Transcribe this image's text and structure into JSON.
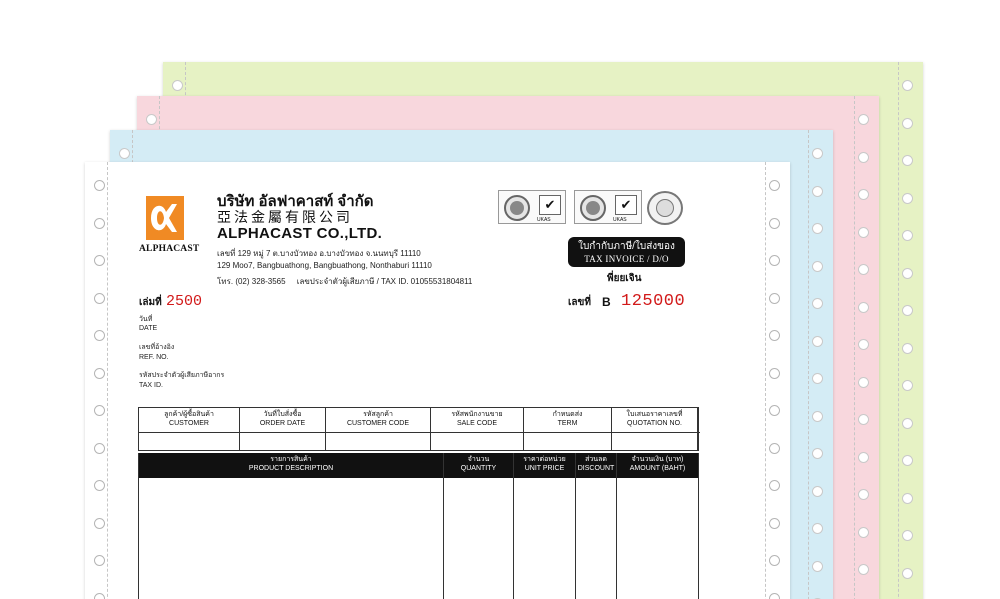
{
  "company": {
    "logo_text": "ALPHACAST",
    "name_thai": "บริษัท อัลฟาคาสท์ จำกัด",
    "name_chinese": "亞法金屬有限公司",
    "name_english": "ALPHACAST CO.,LTD.",
    "address_thai": "เลขที่ 129 หมู่ 7 ต.บางบัวทอง อ.บางบัวทอง จ.นนทบุรี 11110",
    "address_english": "129 Moo7, Bangbuathong, Bangbuathong, Nonthaburi 11110",
    "phone": "โทร. (02) 328-3565",
    "tax_id_line": "เลขประจำตัวผู้เสียภาษี / TAX ID. 01055531804811"
  },
  "certifications": [
    {
      "icon": "iso-certification-icon",
      "tag": "UKAS"
    },
    {
      "icon": "iso-certification-icon",
      "tag": "UKAS"
    },
    {
      "icon": "seal-icon"
    }
  ],
  "document": {
    "title_thai": "ใบกำกับภาษี/ใบส่งของ",
    "title_english": "TAX INVOICE / D/O",
    "copy_label": "พี่ยยเจิน",
    "book_label": "เล่มที่",
    "book_number": "2500",
    "number_label": "เลขที่",
    "number_prefix": "B",
    "number": "125000"
  },
  "fields": [
    {
      "thai": "วันที่",
      "english": "DATE"
    },
    {
      "thai": "เลขที่อ้างอิง",
      "english": "REF. NO."
    },
    {
      "thai": "รหัสประจำตัวผู้เสียภาษีอากร",
      "english": "TAX ID."
    }
  ],
  "customer_table": {
    "columns": [
      {
        "thai": "ลูกค้า/ผู้ซื้อสินค้า",
        "english": "CUSTOMER"
      },
      {
        "thai": "วันที่ใบสั่งซื้อ",
        "english": "ORDER DATE"
      },
      {
        "thai": "รหัสลูกค้า",
        "english": "CUSTOMER CODE"
      },
      {
        "thai": "รหัสพนักงานขาย",
        "english": "SALE CODE"
      },
      {
        "thai": "กำหนดส่ง",
        "english": "TERM"
      },
      {
        "thai": "ใบเสนอราคาเลขที่",
        "english": "QUOTATION NO."
      }
    ]
  },
  "product_table": {
    "columns": [
      {
        "thai": "รายการสินค้า",
        "english": "PRODUCT DESCRIPTION"
      },
      {
        "thai": "จำนวน",
        "english": "QUANTITY"
      },
      {
        "thai": "ราคาต่อหน่วย",
        "english": "UNIT PRICE"
      },
      {
        "thai": "ส่วนลด",
        "english": "DISCOUNT"
      },
      {
        "thai": "จำนวนเงิน (บาท)",
        "english": "AMOUNT (BAHT)"
      }
    ]
  },
  "colors": {
    "logo": "#f08a24",
    "red_numbers": "#d21a1a",
    "sheet_green": "#e6f2c4",
    "sheet_pink": "#f8d7dd",
    "sheet_blue": "#d4ecf5"
  }
}
